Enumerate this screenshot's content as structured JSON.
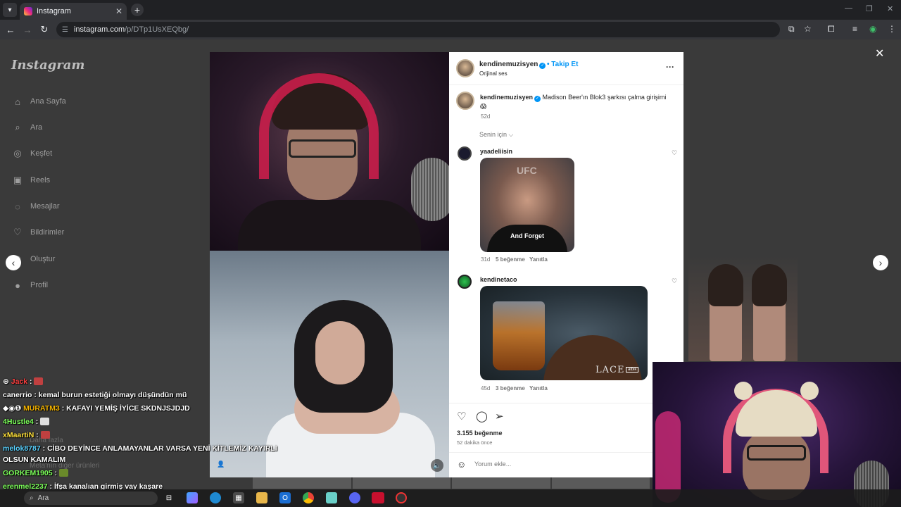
{
  "browser": {
    "tab_title": "Instagram",
    "url_host": "instagram.com",
    "url_path": "/p/DTp1UsXEQbg/"
  },
  "sidebar": {
    "logo": "Instagram",
    "items": [
      {
        "label": "Ana Sayfa",
        "icon": "home-icon"
      },
      {
        "label": "Ara",
        "icon": "search-icon"
      },
      {
        "label": "Keşfet",
        "icon": "compass-icon"
      },
      {
        "label": "Reels",
        "icon": "reels-icon"
      },
      {
        "label": "Mesajlar",
        "icon": "messenger-icon"
      },
      {
        "label": "Bildirimler",
        "icon": "heart-icon"
      },
      {
        "label": "Oluştur",
        "icon": "plus-icon"
      },
      {
        "label": "Profil",
        "icon": "profile-icon"
      }
    ]
  },
  "post": {
    "username": "kendinemuzisyen",
    "follow_label": "Takip Et",
    "audio_label": "Orijinal ses",
    "caption_user": "kendinemuzisyen",
    "caption_text": "Madison Beer'ın Blok3 şarkısı çalma girişimi 😱",
    "caption_age": "52d",
    "sort_label": "Senin için",
    "comments": [
      {
        "user": "yaadeliisin",
        "gif_caption": "And Forget",
        "age": "31d",
        "likes": "5 beğenme",
        "reply": "Yanıtla"
      },
      {
        "user": "kendinetaco",
        "gif_caption": "LACE",
        "gif_badge": "albik",
        "age": "45d",
        "likes": "3 beğenme",
        "reply": "Yanıtla"
      }
    ],
    "likes_count": "3.155 beğenme",
    "posted_ago": "52 dakika önce",
    "comment_placeholder": "Yorum ekle..."
  },
  "chat": {
    "lines": [
      {
        "user": "Jack",
        "message": "",
        "color": "#ff4040"
      },
      {
        "user": "canerrio",
        "message": "kemal burun estetiği olmayı düşündün mü",
        "color": "#ffffff"
      },
      {
        "user": "MURATM3",
        "message": "KAFAYI YEMİŞ İYİCE SKDNJSJDJD",
        "color": "#f5b400"
      },
      {
        "user": "4Hustle4",
        "message": "",
        "color": "#7cff5a"
      },
      {
        "user": "xMaartiN",
        "message": "",
        "color": "#ffe13a"
      },
      {
        "user": "melok8787",
        "message": "CİBO DEYİNCE ANLAMAYANLAR VARSA YENİ KİTLEMİZ KAYIRLI",
        "color": "#5ad2ff"
      },
      {
        "user": "",
        "message": "OLSUN KAMALIM",
        "color": "#ffffff"
      },
      {
        "user": "GORKEM1905",
        "message": "",
        "color": "#7cff5a"
      },
      {
        "user": "erenmel2237",
        "message": "İfşa kanalıan girmiş vay kaşare",
        "color": "#7cff5a"
      }
    ],
    "ghost_1": "Daha fazla",
    "ghost_2": "Meta'nın diğer ürünleri"
  },
  "taskbar": {
    "search_placeholder": "Ara"
  },
  "colors": {
    "instagram_blue": "#0095f6",
    "panel_bg": "#ffffff",
    "backdrop": "#3a3a3a"
  }
}
